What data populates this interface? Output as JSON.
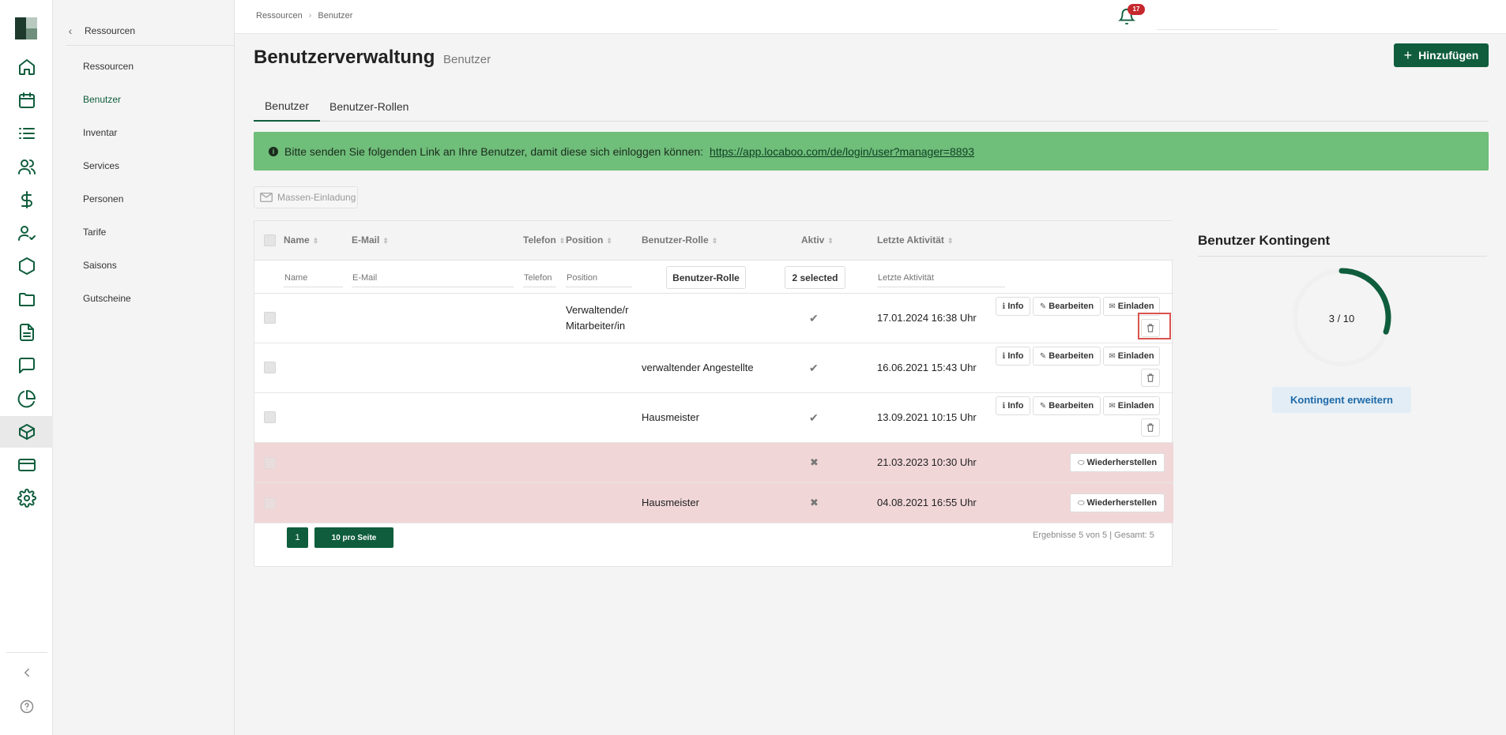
{
  "submenu": {
    "header": "Ressourcen",
    "items": [
      {
        "label": "Ressourcen"
      },
      {
        "label": "Benutzer"
      },
      {
        "label": "Inventar"
      },
      {
        "label": "Services"
      },
      {
        "label": "Personen"
      },
      {
        "label": "Tarife"
      },
      {
        "label": "Saisons"
      },
      {
        "label": "Gutscheine"
      }
    ]
  },
  "rail_icons": [
    "home-icon",
    "calendar-icon",
    "list-icon",
    "users-icon",
    "dollar-icon",
    "user-check-icon",
    "hexagon-icon",
    "folder-icon",
    "document-icon",
    "chat-icon",
    "pie-chart-icon",
    "box-icon",
    "credit-card-icon",
    "gear-icon",
    "collapse-icon",
    "help-icon"
  ],
  "breadcrumb": {
    "first": "Ressourcen",
    "second": "Benutzer"
  },
  "notifications": {
    "count": "17"
  },
  "page": {
    "title": "Benutzerverwaltung",
    "subtitle": "Benutzer",
    "add_label": "Hinzufügen"
  },
  "tabs": [
    {
      "label": "Benutzer"
    },
    {
      "label": "Benutzer-Rollen"
    }
  ],
  "alert": {
    "text": "Bitte senden Sie folgenden Link an Ihre Benutzer, damit diese sich einloggen können:",
    "link": "https://app.locaboo.com/de/login/user?manager=8893"
  },
  "mass_invite": "Massen-Einladung",
  "table": {
    "columns": {
      "name": "Name",
      "email": "E-Mail",
      "telefon": "Telefon",
      "position": "Position",
      "rolle": "Benutzer-Rolle",
      "aktiv": "Aktiv",
      "letzte": "Letzte Aktivität"
    },
    "filters": {
      "name": "Name",
      "email": "E-Mail",
      "telefon": "Telefon",
      "position": "Position",
      "rolle": "Benutzer-Rolle",
      "aktiv": "2 selected",
      "letzte": "Letzte Aktivität"
    },
    "rows": [
      {
        "position_1": "Verwaltende/r",
        "position_2": "Mitarbeiter/in",
        "rolle": "",
        "aktiv": "✔",
        "letzte": "17.01.2024 16:38 Uhr"
      },
      {
        "position_1": "",
        "position_2": "",
        "rolle": "verwaltender Angestellte",
        "aktiv": "✔",
        "letzte": "16.06.2021 15:43 Uhr"
      },
      {
        "position_1": "",
        "position_2": "",
        "rolle": "Hausmeister",
        "aktiv": "✔",
        "letzte": "13.09.2021 10:15 Uhr"
      },
      {
        "rolle": "",
        "aktiv": "✖",
        "letzte": "21.03.2023 10:30 Uhr"
      },
      {
        "rolle": "Hausmeister",
        "aktiv": "✖",
        "letzte": "04.08.2021 16:55 Uhr"
      }
    ],
    "actions": {
      "info": "Info",
      "edit": "Bearbeiten",
      "invite": "Einladen",
      "restore": "Wiederherstellen"
    }
  },
  "pagination": {
    "page": "1",
    "per_page": "10 pro Seite",
    "results": "Ergebnisse 5 von 5 | Gesamt: 5"
  },
  "quota": {
    "title": "Benutzer Kontingent",
    "used": 3,
    "total": 10,
    "label": "3 / 10",
    "button": "Kontingent erweitern"
  },
  "colors": {
    "brand": "#0f5d3c",
    "alert_bg": "#6fbe7a",
    "deleted_row": "#f1d6d8",
    "badge": "#c6282e"
  }
}
